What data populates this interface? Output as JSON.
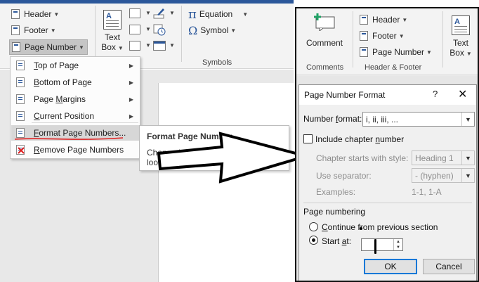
{
  "left": {
    "ribbon": {
      "header": "Header",
      "footer": "Footer",
      "page_number": "Page Number",
      "text_box_line1": "Text",
      "text_box_line2": "Box",
      "equation": "Equation",
      "symbol": "Symbol",
      "symbols_group": "Symbols",
      "pi_glyph": "π",
      "omega_glyph": "Ω"
    },
    "menu": {
      "items": [
        {
          "pre": "",
          "u": "T",
          "post": "op of Page",
          "submenu": true
        },
        {
          "pre": "",
          "u": "B",
          "post": "ottom of Page",
          "submenu": true
        },
        {
          "pre": "Page ",
          "u": "M",
          "post": "argins",
          "submenu": true
        },
        {
          "pre": "",
          "u": "C",
          "post": "urrent Position",
          "submenu": true
        },
        {
          "pre": "",
          "u": "F",
          "post": "ormat Page Numbers...",
          "submenu": false
        },
        {
          "pre": "",
          "u": "R",
          "post": "emove Page Numbers",
          "submenu": false
        }
      ]
    },
    "tooltip": {
      "title": "Format Page Number",
      "body_line1": "Change how the page numbers",
      "body_line2": "look in the header/footer."
    },
    "annotation_color": "#e02020"
  },
  "right": {
    "ribbon": {
      "comment": "Comment",
      "comments_group": "Comments",
      "header": "Header",
      "footer": "Footer",
      "page_number": "Page Number",
      "header_footer_group": "Header & Footer",
      "text_box_line1": "Text",
      "text_box_line2": "Box"
    },
    "dialog": {
      "title": "Page Number Format",
      "help": "?",
      "close": "✕",
      "number_format_pre": "Number ",
      "number_format_u": "f",
      "number_format_post": "ormat:",
      "number_format_value": "i, ii, iii, ...",
      "include_chapter_pre": "Include chapter ",
      "include_chapter_u": "n",
      "include_chapter_post": "umber",
      "chapter_style_label": "Chapter starts with style:",
      "chapter_style_value": "Heading 1",
      "separator_label": "Use separator:",
      "separator_value": "-   (hyphen)",
      "examples_label": "Examples:",
      "examples_value": "1-1, 1-A",
      "page_numbering_label": "Page numbering",
      "continue_pre": "",
      "continue_u": "C",
      "continue_post": "ontinue from previous section",
      "start_at_pre": "Start ",
      "start_at_u": "a",
      "start_at_post": "t:",
      "start_at_value": "",
      "ok": "OK",
      "cancel": "Cancel"
    }
  },
  "colors": {
    "accent": "#2b579a",
    "comment_green": "#21a366",
    "ok_border": "#0078d7"
  }
}
